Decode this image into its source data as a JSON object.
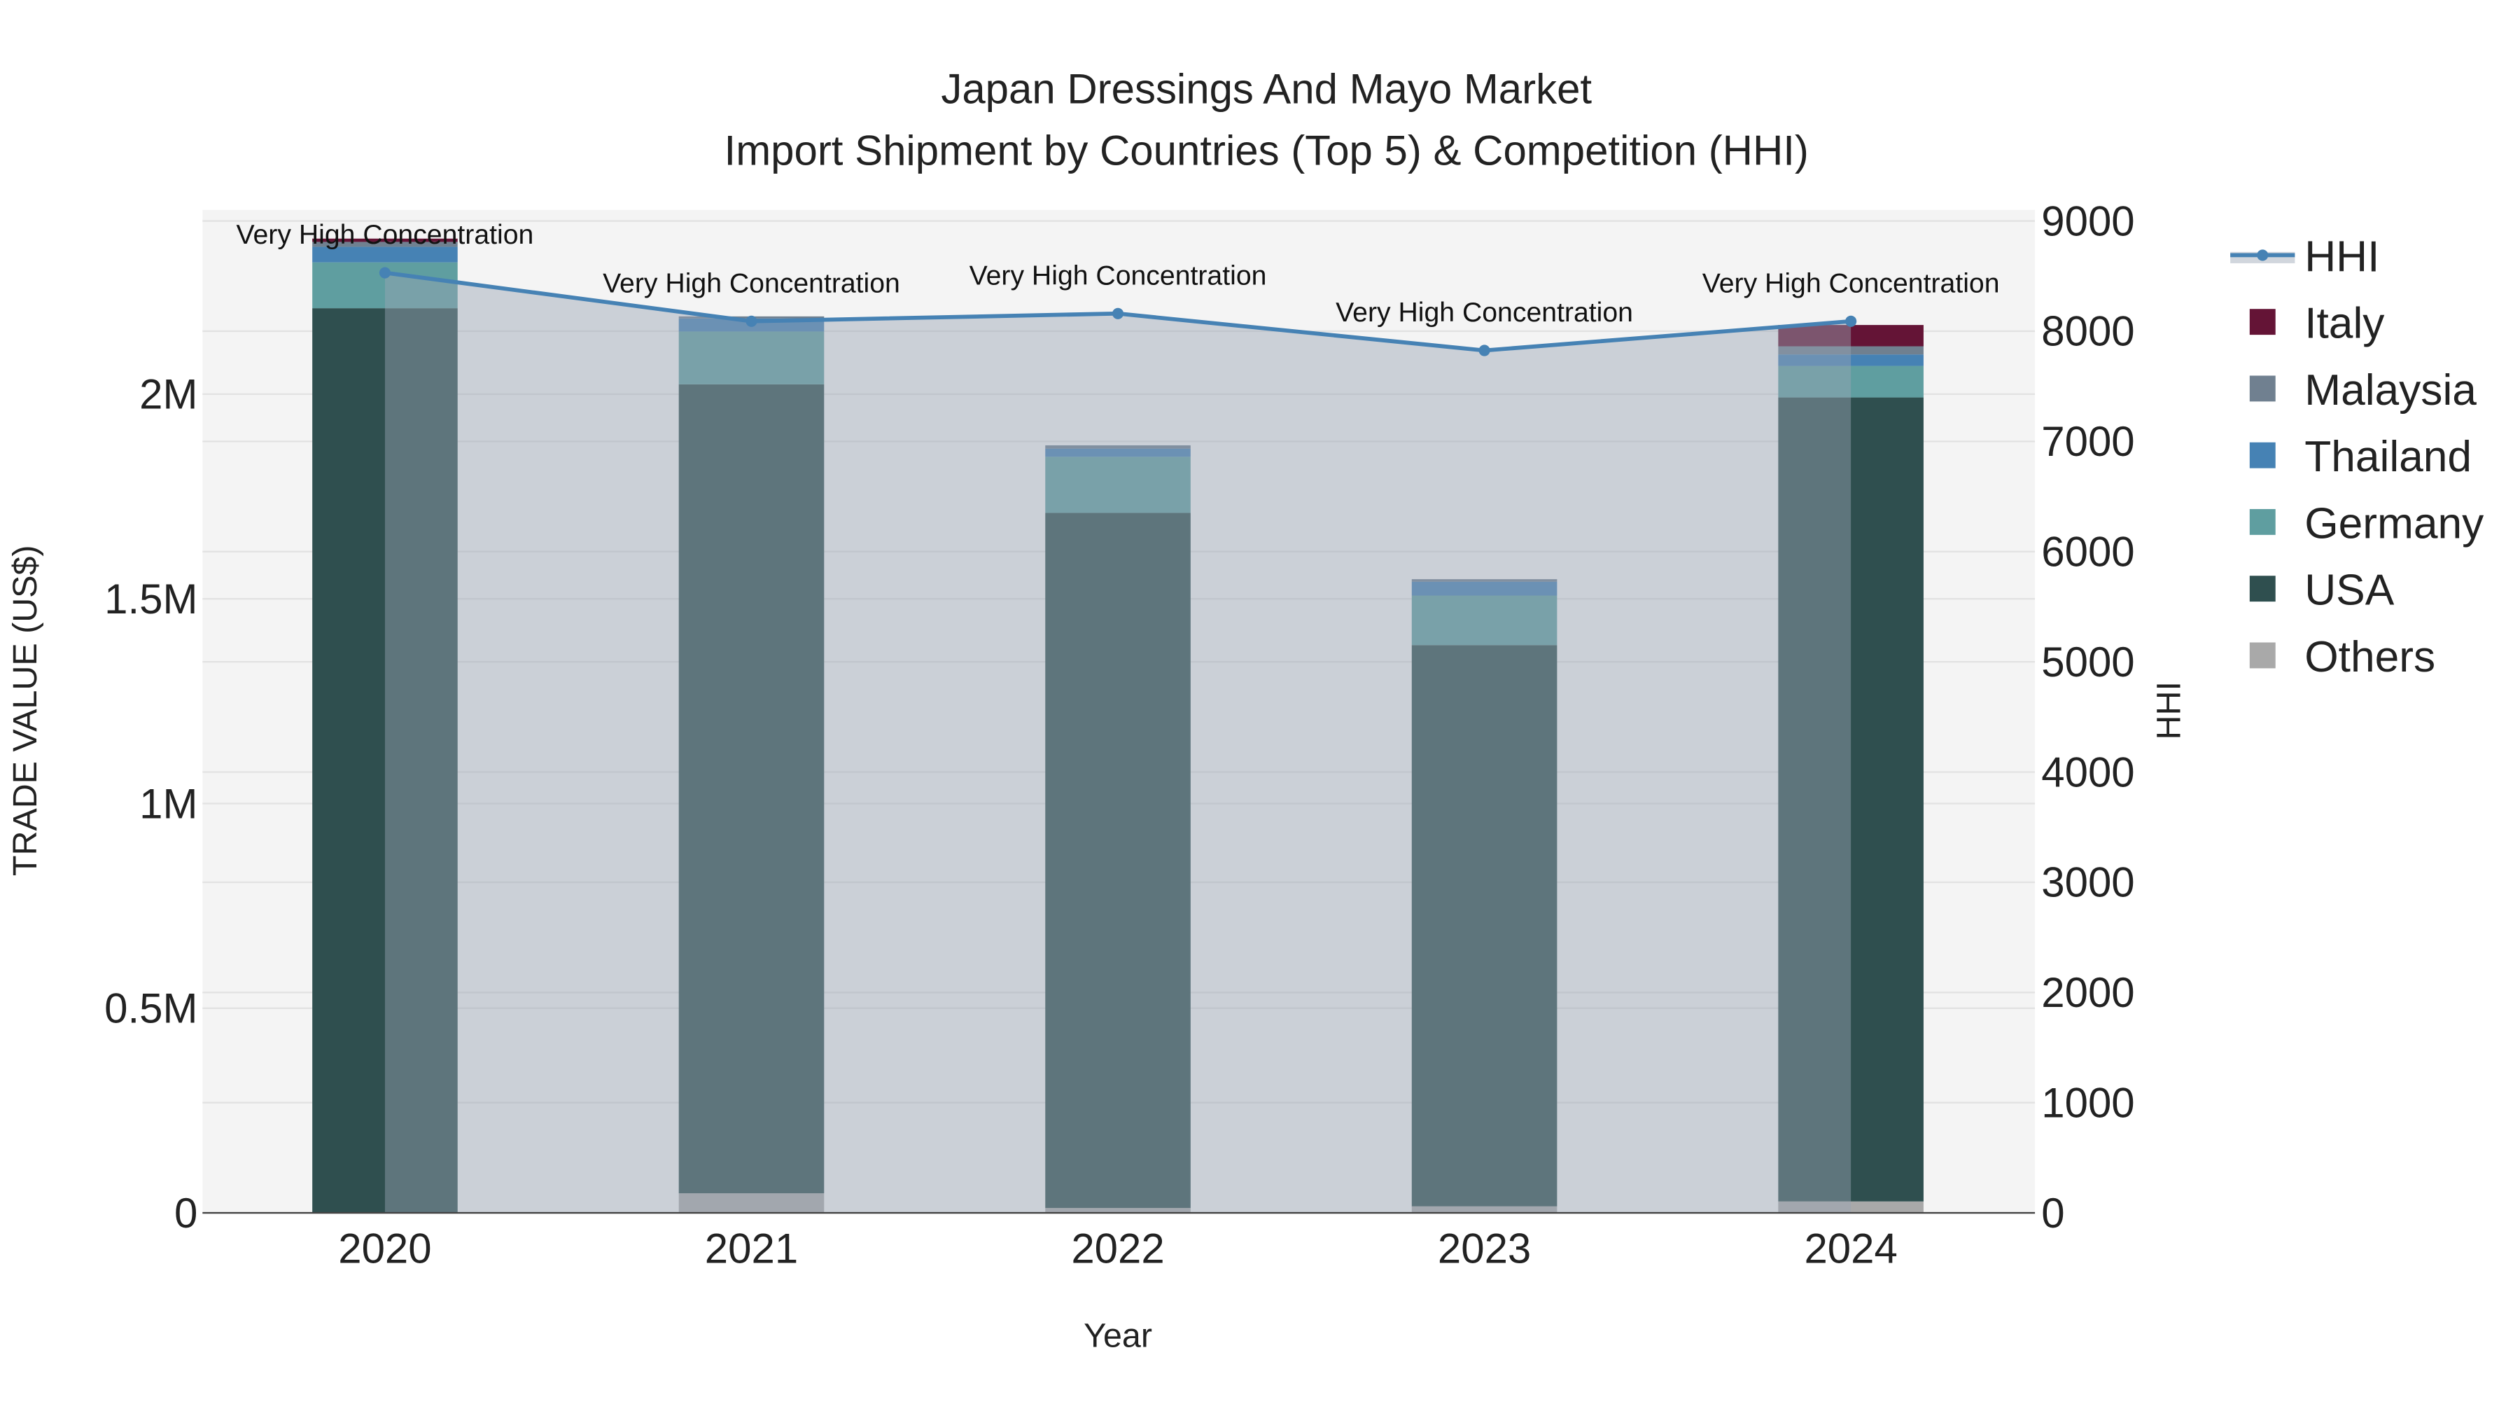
{
  "chart_data": {
    "type": "bar",
    "title_line1": "Japan Dressings And Mayo Market",
    "title_line2": "Import Shipment by Countries (Top 5) & Competition (HHI)",
    "xlabel": "Year",
    "ylabel": "TRADE VALUE (US$)",
    "y2label": "HHI",
    "categories": [
      "2020",
      "2021",
      "2022",
      "2023",
      "2024"
    ],
    "ylim": [
      0,
      2450000
    ],
    "y2lim": [
      0,
      9100
    ],
    "yticks": [
      {
        "v": 0,
        "label": "0"
      },
      {
        "v": 500000,
        "label": "0.5M"
      },
      {
        "v": 1000000,
        "label": "1M"
      },
      {
        "v": 1500000,
        "label": "1.5M"
      },
      {
        "v": 2000000,
        "label": "2M"
      }
    ],
    "y2ticks": [
      0,
      1000,
      2000,
      3000,
      4000,
      5000,
      6000,
      7000,
      8000,
      9000
    ],
    "series": [
      {
        "name": "Others",
        "color": "#A9A9A9",
        "values": [
          0,
          48000,
          12000,
          16000,
          28000
        ]
      },
      {
        "name": "USA",
        "color": "#2F4F4F",
        "values": [
          2210000,
          1976000,
          1698000,
          1371000,
          1964000
        ]
      },
      {
        "name": "Germany",
        "color": "#5F9EA0",
        "values": [
          112000,
          129000,
          137000,
          121000,
          77000
        ]
      },
      {
        "name": "Thailand",
        "color": "#4682B4",
        "values": [
          38000,
          32000,
          20000,
          34000,
          28000
        ]
      },
      {
        "name": "Malaysia",
        "color": "#708090",
        "values": [
          12000,
          5000,
          8000,
          6000,
          20000
        ]
      },
      {
        "name": "Italy",
        "color": "#641436",
        "values": [
          8000,
          0,
          0,
          0,
          52000
        ]
      }
    ],
    "hhi": {
      "name": "HHI",
      "color": "#4682B4",
      "values": [
        8530,
        8090,
        8160,
        7825,
        8090
      ],
      "annotations": [
        "Very High Concentration",
        "Very High Concentration",
        "Very High Concentration",
        "Very High Concentration",
        "Very High Concentration"
      ]
    },
    "legend": [
      "HHI",
      "Italy",
      "Malaysia",
      "Thailand",
      "Germany",
      "USA",
      "Others"
    ],
    "legend_position": "right",
    "grid": true
  }
}
